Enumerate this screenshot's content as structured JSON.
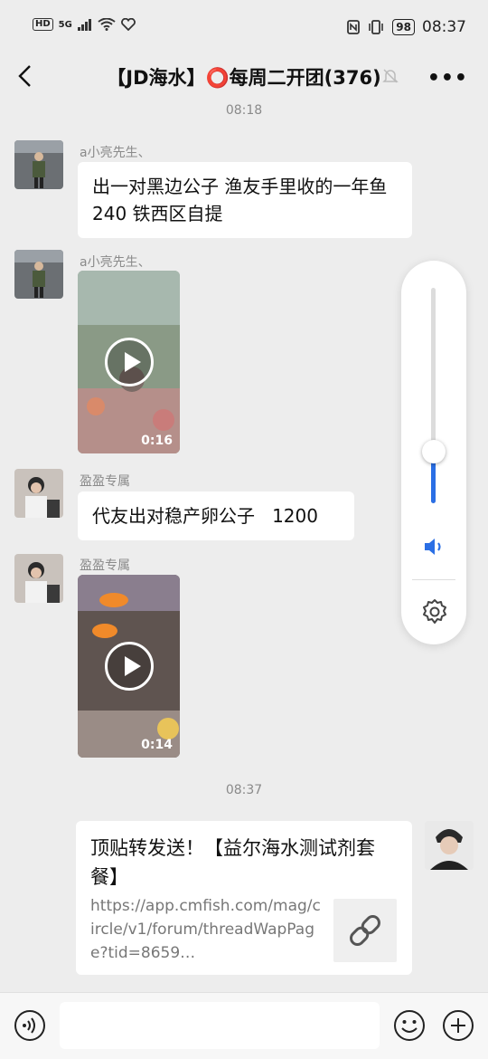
{
  "status_bar": {
    "left_chips": [
      "HD",
      "5G"
    ],
    "battery": "98",
    "time": "08:37"
  },
  "header": {
    "title": "【JD海水】⭕每周二开团(376)",
    "icons": [
      "back-icon",
      "mute-bell-icon",
      "more-icon"
    ]
  },
  "messages": [
    {
      "type": "timestamp",
      "text": "08:18"
    },
    {
      "type": "text",
      "sender": "a小亮先生、",
      "text": "出一对黑边公子 渔友手里收的一年鱼 240 铁西区自提"
    },
    {
      "type": "video",
      "sender": "a小亮先生、",
      "duration": "0:16"
    },
    {
      "type": "text",
      "sender": "盈盈专属",
      "text": "代友出对稳产卵公子   1200"
    },
    {
      "type": "video",
      "sender": "盈盈专属",
      "duration": "0:14"
    },
    {
      "type": "timestamp",
      "text": "08:37"
    },
    {
      "type": "link",
      "title": "顶贴转发送！【益尔海水测试剂套餐】",
      "url": "https://app.cmfish.com/mag/circle/v1/forum/threadWapPage?tid=8659…"
    }
  ],
  "volume_panel": {
    "level": 0.24,
    "accent_color": "#2b6fe5",
    "icons": [
      "speaker-icon",
      "settings-gear-icon"
    ]
  },
  "input_bar": {
    "icons": [
      "voice-icon",
      "emoji-icon",
      "add-icon"
    ]
  }
}
